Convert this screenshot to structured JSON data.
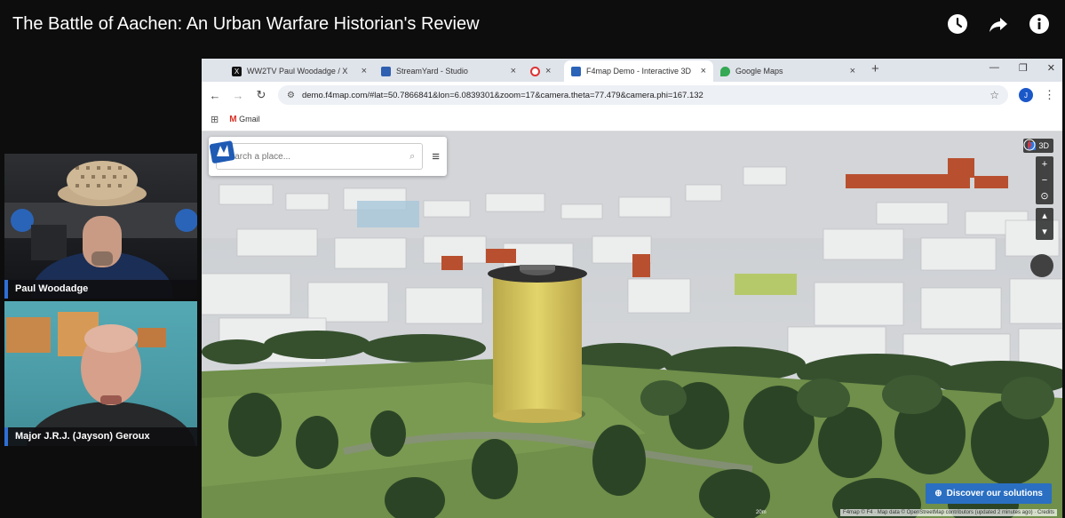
{
  "video": {
    "title": "The Battle of Aachen: An Urban Warfare Historian's Review",
    "icons": [
      "watch-later-icon",
      "share-icon",
      "info-icon"
    ]
  },
  "participants": [
    {
      "name": "Paul Woodadge"
    },
    {
      "name": "Major J.R.J. (Jayson) Geroux"
    }
  ],
  "browser": {
    "tabs": [
      {
        "label": "WW2TV Paul Woodadge / X",
        "icon": "x-logo-icon",
        "active": false
      },
      {
        "label": "StreamYard - Studio",
        "icon": "streamyard-icon",
        "active": false
      },
      {
        "label": "",
        "icon": "recording-icon",
        "active": false
      },
      {
        "label": "F4map Demo - Interactive 3D",
        "icon": "f4map-icon",
        "active": true
      },
      {
        "label": "Google Maps",
        "icon": "google-maps-icon",
        "active": false
      }
    ],
    "new_tab": "+",
    "url": "demo.f4map.com/#lat=50.7866841&lon=6.0839301&zoom=17&camera.theta=77.479&camera.phi=167.132",
    "profile_initial": "J",
    "bookmarks": [
      {
        "label": "Gmail"
      }
    ]
  },
  "map": {
    "search_placeholder": "Search a place...",
    "toggle_3d_label": "3D",
    "zoom_in": "+",
    "zoom_out": "−",
    "discover_label": "Discover our solutions",
    "attribution": "F4map © F4 · Map data © OpenStreetMap contributors (updated 2 minutes ago) · Credits",
    "scale_label": "20m"
  },
  "colors": {
    "accent": "#2f6fd6",
    "discover_button": "#2a6fc2",
    "tower": "#d8c65a",
    "grass": "#6f8f4a"
  }
}
